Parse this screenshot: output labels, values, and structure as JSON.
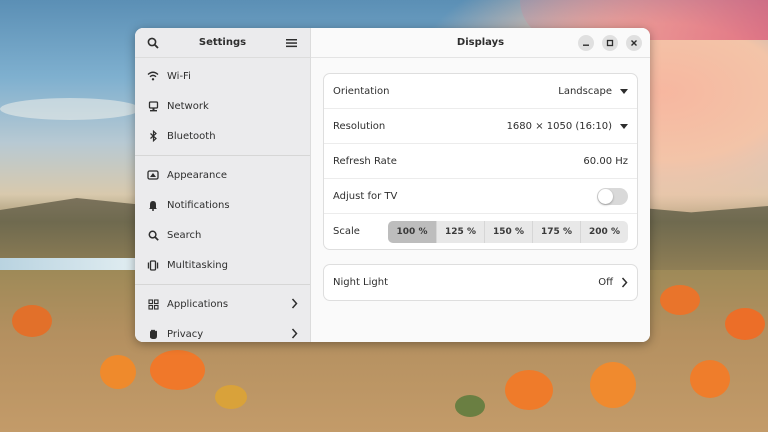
{
  "sidebar": {
    "title": "Settings",
    "items": [
      {
        "label": "Wi-Fi",
        "icon": "wifi-icon"
      },
      {
        "label": "Network",
        "icon": "network-icon"
      },
      {
        "label": "Bluetooth",
        "icon": "bluetooth-icon"
      },
      {
        "label": "Appearance",
        "icon": "appearance-icon"
      },
      {
        "label": "Notifications",
        "icon": "bell-icon"
      },
      {
        "label": "Search",
        "icon": "search-icon"
      },
      {
        "label": "Multitasking",
        "icon": "multitasking-icon"
      },
      {
        "label": "Applications",
        "icon": "grid-icon"
      },
      {
        "label": "Privacy",
        "icon": "hand-icon"
      }
    ]
  },
  "main": {
    "title": "Displays",
    "orientation": {
      "label": "Orientation",
      "value": "Landscape"
    },
    "resolution": {
      "label": "Resolution",
      "value": "1680 × 1050 (16:10)"
    },
    "refresh_rate": {
      "label": "Refresh Rate",
      "value": "60.00 Hz"
    },
    "adjust_tv": {
      "label": "Adjust for TV",
      "enabled": false
    },
    "scale": {
      "label": "Scale",
      "options": [
        "100 %",
        "125 %",
        "150 %",
        "175 %",
        "200 %"
      ],
      "selected": "100 %"
    },
    "night_light": {
      "label": "Night Light",
      "value": "Off"
    }
  },
  "colors": {
    "accent_selected": "#bdbdbd",
    "window_bg": "#fafafa",
    "sidebar_bg": "#ebebed"
  }
}
